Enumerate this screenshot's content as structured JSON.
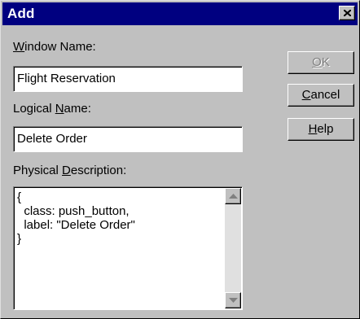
{
  "window": {
    "title": "Add",
    "close_icon": "close-icon"
  },
  "fields": {
    "window_name": {
      "label_mnemonic": "W",
      "label_rest": "indow Name:",
      "value": "Flight Reservation"
    },
    "logical_name": {
      "label_pre": "Logical ",
      "label_mnemonic": "N",
      "label_rest": "ame:",
      "value": "Delete Order"
    },
    "physical_description": {
      "label_pre": "Physical ",
      "label_mnemonic": "D",
      "label_rest": "escription:",
      "value": "{\n  class: push_button,\n  label: \"Delete Order\"\n}"
    }
  },
  "buttons": {
    "ok": {
      "mnemonic": "O",
      "rest": "K",
      "enabled": false
    },
    "cancel": {
      "mnemonic": "C",
      "rest": "ancel"
    },
    "help": {
      "mnemonic": "H",
      "rest": "elp"
    }
  },
  "colors": {
    "titlebar": "#000080",
    "face": "#c0c0c0",
    "disabled_text": "#808080"
  }
}
